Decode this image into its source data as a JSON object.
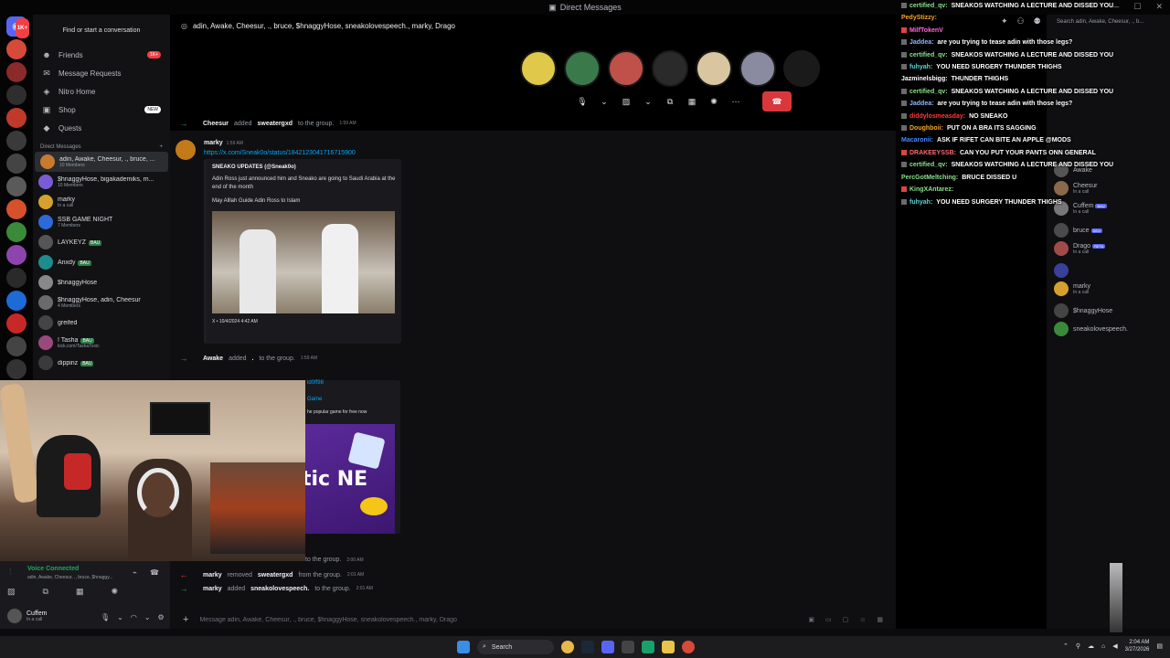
{
  "window": {
    "title": "Direct Messages"
  },
  "sidebar": {
    "find_placeholder": "Find or start a conversation",
    "nav": [
      {
        "label": "Friends",
        "badge": "1K+"
      },
      {
        "label": "Message Requests",
        "badge": ""
      },
      {
        "label": "Nitro Home",
        "badge": ""
      },
      {
        "label": "Shop",
        "badge": "NEW"
      },
      {
        "label": "Quests",
        "badge": ""
      }
    ],
    "dm_header": "Direct Messages",
    "dms": [
      {
        "name": "adin, Awake, Cheesur, ., bruce, ...",
        "sub": "10 Members",
        "tag": "",
        "color": "#c77b2e"
      },
      {
        "name": "$hnaggyHose, bigakademiks, m...",
        "sub": "10 Members",
        "tag": "",
        "color": "#7a5bd6"
      },
      {
        "name": "marky",
        "sub": "In a call",
        "tag": "",
        "color": "#d6a02e"
      },
      {
        "name": "SSB GAME NIGHT",
        "sub": "7 Members",
        "tag": "",
        "color": "#2e6ad6"
      },
      {
        "name": "LAYKEYZ",
        "sub": "",
        "tag": "BAU",
        "color": "#555"
      },
      {
        "name": "Anxdy",
        "sub": "",
        "tag": "BAU",
        "color": "#1e8c8c"
      },
      {
        "name": "$hnaggyHose",
        "sub": "",
        "tag": "",
        "color": "#888"
      },
      {
        "name": "$hnaggyHose, adin, Cheesur",
        "sub": "4 Members",
        "tag": "",
        "color": "#6a6a6a"
      },
      {
        "name": "greifed",
        "sub": "",
        "tag": "",
        "color": "#444"
      },
      {
        "name": "! Tasha",
        "sub": "kick.com/TashaToxic",
        "tag": "BAU",
        "color": "#9a4a7a"
      },
      {
        "name": "dippinz",
        "sub": "",
        "tag": "BAU",
        "color": "#3a3a3a"
      }
    ]
  },
  "guild_badge": "1K+",
  "header": {
    "group_name": "adin, Awake, Cheesur, ., bruce, $hnaggyHose, sneakolovespeech., marky, Drago"
  },
  "call": {
    "participants": [
      "#e0c84a",
      "#3a7a4a",
      "#c0504a",
      "#2a2a2a",
      "#d9c6a0",
      "#8a8aa0",
      "#1a1a1a"
    ]
  },
  "messages": {
    "sys1": {
      "user": "Cheesur",
      "action": "added",
      "target": "sweatergxd",
      "rest": "to the group.",
      "time": "1:59 AM"
    },
    "m1": {
      "author": "marky",
      "time": "1:59 AM",
      "link": "https://x.com/Sneak0o/status/1842123041716715900"
    },
    "embed": {
      "title": "SNEAKO UPDATES (@Sneak0o)",
      "desc1": "Adin Ross just announced him and Sneako are going to Saudi Arabia at the end of the month",
      "desc2": "May Alllah Guide Adin Ross to Islam",
      "footer": "X • 10/4/2024 4:42 AM"
    },
    "sys2": {
      "user": "Awake",
      "action": "added",
      "target": ".",
      "rest": "to the group.",
      "time": "1:59 AM"
    },
    "embed2": {
      "link_tail": "ld0ff98",
      "title": "Game",
      "desc": "he popular game for free now",
      "art_text": "tic NE"
    },
    "sys3": {
      "text": "to the group.",
      "time": "2:00 AM"
    },
    "sys4": {
      "user": "marky",
      "action": "removed",
      "target": "sweatergxd",
      "rest": "from the group.",
      "time": "2:01 AM"
    },
    "sys5": {
      "user": "marky",
      "action": "added",
      "target": "sneakolovespeech.",
      "rest": "to the group.",
      "time": "2:01 AM"
    }
  },
  "composer": {
    "placeholder": "Message adin, Awake, Cheesur, ., bruce, $hnaggyHose, sneakolovespeech., marky, Drago"
  },
  "search": {
    "placeholder": "Search adin, Awake, Cheesur, ., b..."
  },
  "members": [
    {
      "name": "Awake",
      "sub": "",
      "tag": "",
      "color": "#555"
    },
    {
      "name": "Cheesur",
      "sub": "In a call",
      "tag": "",
      "color": "#8a6a4a"
    },
    {
      "name": "Cuffem",
      "sub": "In a call",
      "tag": "BAU",
      "color": "#777"
    },
    {
      "name": "bruce",
      "sub": "",
      "tag": "DEO",
      "color": "#4a4a4a"
    },
    {
      "name": "Drago",
      "sub": "In a call",
      "tag": "RETA",
      "color": "#a04a4a"
    },
    {
      "name": "",
      "sub": "",
      "tag": "",
      "color": "#3a3f9a"
    },
    {
      "name": "marky",
      "sub": "In a call",
      "tag": "",
      "color": "#d6a02e"
    },
    {
      "name": "$hnaggyHose",
      "sub": "",
      "tag": "",
      "color": "#444"
    },
    {
      "name": "sneakolovespeech.",
      "sub": "",
      "tag": "",
      "color": "#3a8a3a"
    }
  ],
  "chat": [
    {
      "user": "certified_qv:",
      "text": "SNEAKOS WATCHING A LECTURE AND DISSED YOU",
      "ucolor": "#8be08b",
      "sq": "#6a6a6a"
    },
    {
      "user": "PedyStizzy:",
      "text": "",
      "ucolor": "#f5a623",
      "sq": ""
    },
    {
      "user": "MilfTokenV",
      "text": "",
      "ucolor": "#ff6ad5",
      "sq": "#d44"
    },
    {
      "user": "Jaddea:",
      "text": "are you trying to tease adin with those legs?",
      "ucolor": "#8fb8ff",
      "sq": "#6a6a6a"
    },
    {
      "user": "certified_qv:",
      "text": "SNEAKOS WATCHING A LECTURE AND DISSED YOU",
      "ucolor": "#8be08b",
      "sq": "#6a6a6a"
    },
    {
      "user": "fuhyah:",
      "text": "YOU NEED SURGERY THUNDER THIGHS",
      "ucolor": "#5ad6d6",
      "sq": "#6a6a6a"
    },
    {
      "user": "Jazminelsbigg:",
      "text": "THUNDER THIGHS",
      "ucolor": "#ffffff",
      "sq": ""
    },
    {
      "user": "certified_qv:",
      "text": "SNEAKOS WATCHING A LECTURE AND DISSED YOU",
      "ucolor": "#8be08b",
      "sq": "#6a6a6a"
    },
    {
      "user": "Jaddea:",
      "text": "are you trying to tease adin with those legs?",
      "ucolor": "#8fb8ff",
      "sq": "#6a6a6a"
    },
    {
      "user": "diddylosmeasday:",
      "text": "NO SNEAKO",
      "ucolor": "#ff3a3a",
      "sq": "#6a6a6a"
    },
    {
      "user": "Doughboii:",
      "text": "PUT ON A BRA ITS SAGGING",
      "ucolor": "#f5a623",
      "sq": "#6a6a6a"
    },
    {
      "user": "Macaronii:",
      "text": "ASK IF RIFET CAN BITE AN APPLE @MODS",
      "ucolor": "#4a8aff",
      "sq": ""
    },
    {
      "user": "DRAKEEYSSB:",
      "text": "CAN YOU PUT YOUR PANTS ONN GENERAL",
      "ucolor": "#ff6a6a",
      "sq": "#d44"
    },
    {
      "user": "certified_qv:",
      "text": "SNEAKOS WATCHING A LECTURE AND DISSED YOU",
      "ucolor": "#8be08b",
      "sq": "#6a6a6a"
    },
    {
      "user": "PercGotMeltching:",
      "text": "BRUCE DISSED U",
      "ucolor": "#8be08b",
      "sq": ""
    },
    {
      "user": "KingXAntarez:",
      "text": "",
      "ucolor": "#8be08b",
      "sq": "#d44"
    },
    {
      "user": "fuhyah:",
      "text": "YOU NEED SURGERY THUNDER THIGHS",
      "ucolor": "#5ad6d6",
      "sq": "#6a6a6a"
    }
  ],
  "voice": {
    "status": "Voice Connected",
    "channel": "adin, Awake, Cheesur, ., bruce, $hnaggy..."
  },
  "user": {
    "name": "Cuffem",
    "status": "In a call"
  },
  "taskbar": {
    "search": "Search",
    "time": "2:04 AM",
    "date": "3/27/2026"
  }
}
